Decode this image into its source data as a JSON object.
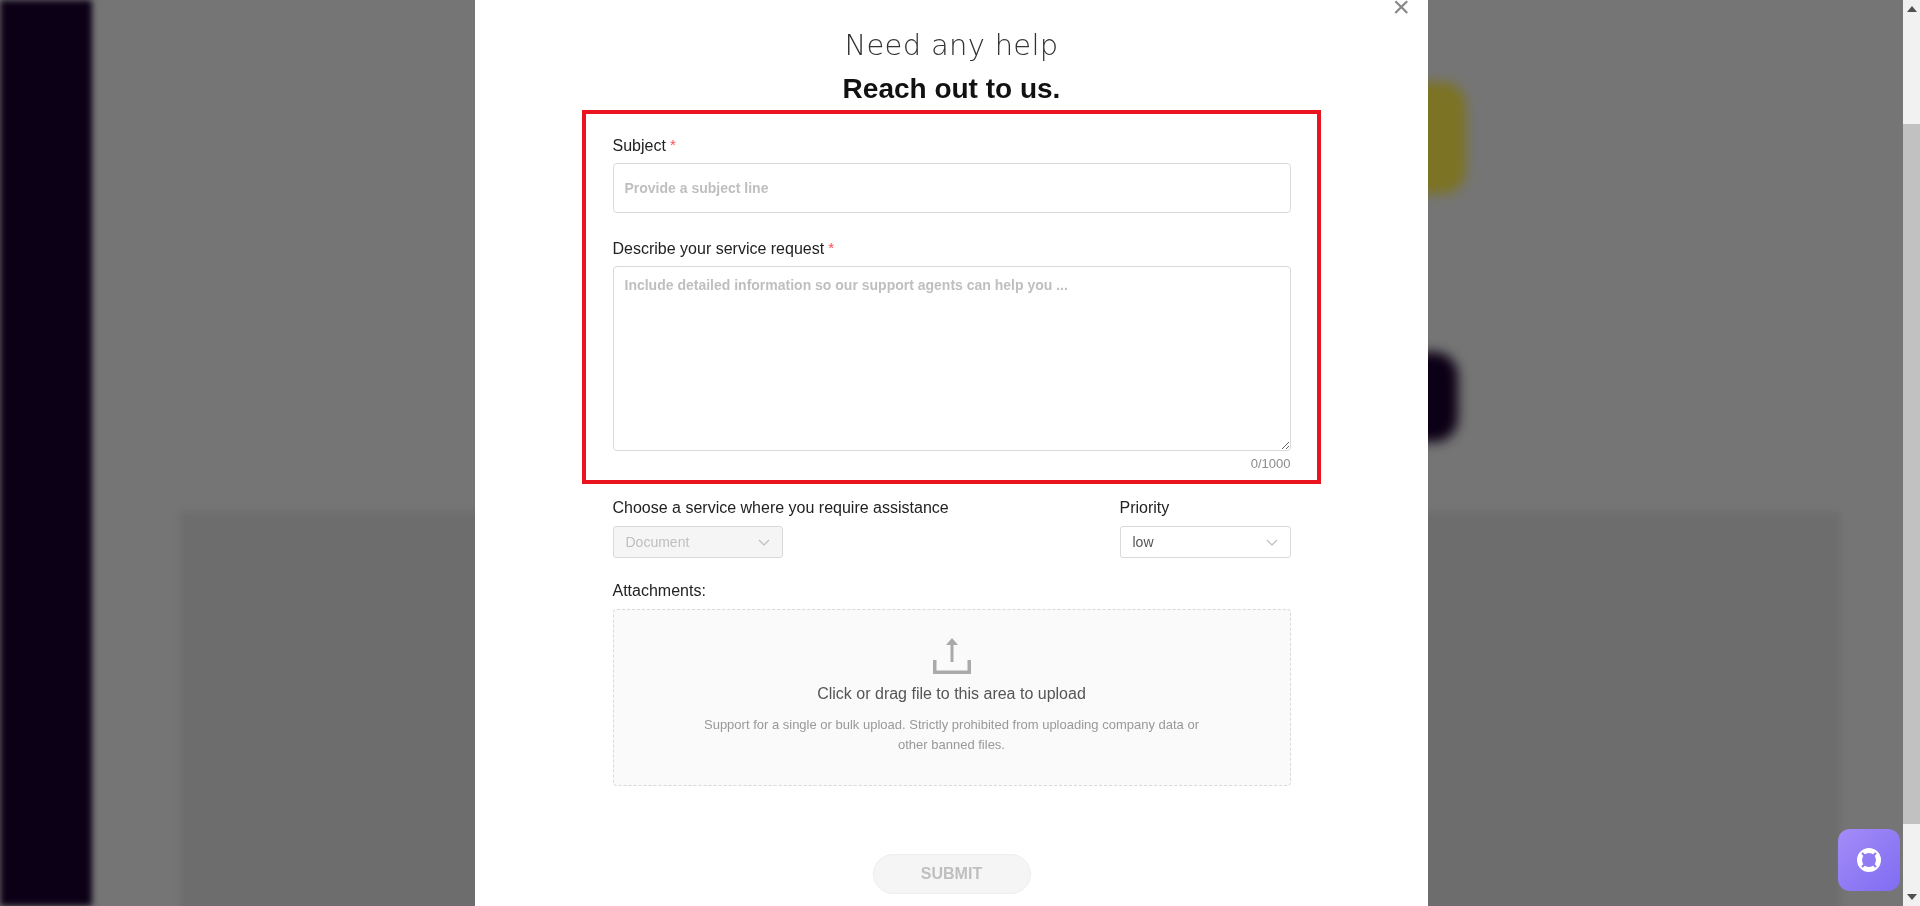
{
  "modal": {
    "title": "Need any help",
    "heading": "Reach out to us.",
    "close": "×"
  },
  "fields": [
    {
      "kind": "input",
      "label": "Subject",
      "required": true,
      "required_mark": "*",
      "placeholder": "Provide a subject line"
    },
    {
      "kind": "textarea",
      "label": "Describe your service request",
      "required": true,
      "required_mark": "*",
      "placeholder": "Include detailed information so our support agents can help you ...",
      "counter": "0/1000"
    }
  ],
  "service": {
    "label": "Choose a service where you require assistance",
    "value": "Document",
    "disabled": true
  },
  "priority": {
    "label": "Priority",
    "value": "low",
    "disabled": false
  },
  "attachments": {
    "label": "Attachments:",
    "title": "Click or drag file to this area to upload",
    "hint": "Support for a single or bulk upload. Strictly prohibited from uploading company data or other banned files."
  },
  "submit": {
    "label": "SUBMIT",
    "disabled": true
  }
}
